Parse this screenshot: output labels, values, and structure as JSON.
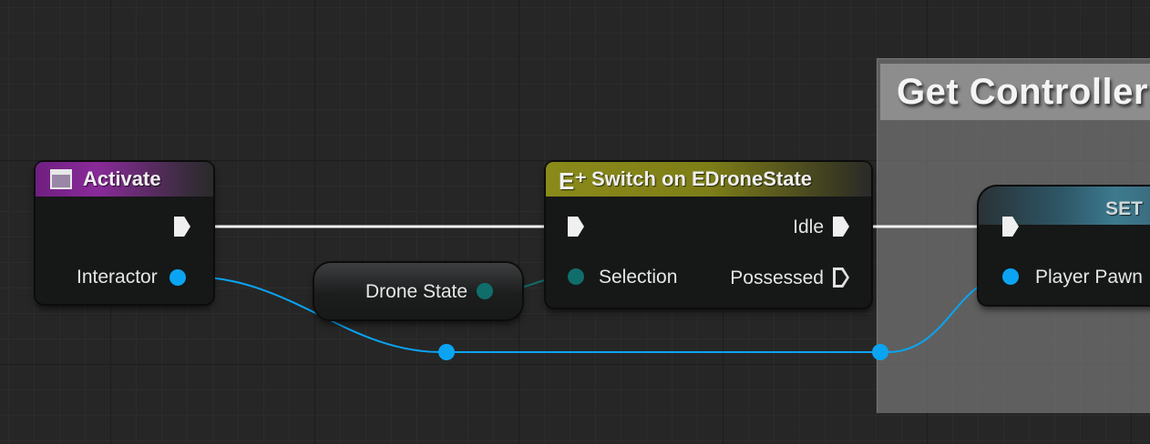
{
  "comment": {
    "title": "Get Controller"
  },
  "nodes": {
    "activate": {
      "title": "Activate",
      "pin_label": "Interactor",
      "icon": "function-icon"
    },
    "switch": {
      "title": "Switch on EDroneState",
      "selection_label": "Selection",
      "out1_label": "Idle",
      "out2_label": "Possessed",
      "icon": "switch-icon"
    },
    "drone_state": {
      "label": "Drone State"
    },
    "set": {
      "title": "SET",
      "pin_label": "Player Pawn"
    }
  },
  "colors": {
    "exec_wire": "#ffffff",
    "object_wire": "#0aa4f2",
    "enum_wire": "#0f6e6a",
    "activate_header": "#8a2a9a",
    "switch_header": "#8a8a1a",
    "set_header": "#3d7a8e"
  }
}
